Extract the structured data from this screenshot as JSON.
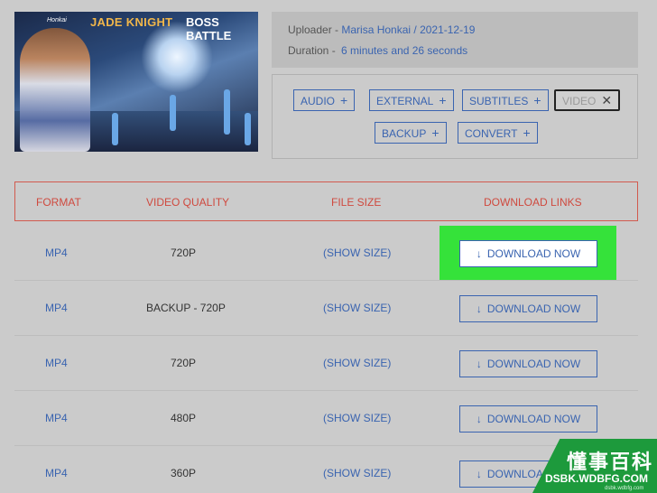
{
  "video": {
    "thumbnail": {
      "title_part1": "JADE KNIGHT",
      "title_part2": "BOSS BATTLE",
      "badge": "Honkai"
    },
    "uploader_label": "Uploader -",
    "uploader_value": "Marisa Honkai / 2021-12-19",
    "duration_label": "Duration -",
    "duration_value": "6 minutes and 26 seconds"
  },
  "tags": [
    {
      "label": "AUDIO",
      "icon": "plus-icon",
      "active": false
    },
    {
      "label": "EXTERNAL",
      "icon": "plus-icon",
      "active": false
    },
    {
      "label": "SUBTITLES",
      "icon": "plus-icon",
      "active": false
    },
    {
      "label": "VIDEO",
      "icon": "close-icon",
      "active": true
    },
    {
      "label": "BACKUP",
      "icon": "plus-icon",
      "active": false
    },
    {
      "label": "CONVERT",
      "icon": "plus-icon",
      "active": false
    }
  ],
  "table": {
    "headers": [
      "FORMAT",
      "VIDEO QUALITY",
      "FILE SIZE",
      "DOWNLOAD LINKS"
    ],
    "rows": [
      {
        "format": "MP4",
        "quality": "720P",
        "size": "(SHOW SIZE)",
        "link": "DOWNLOAD NOW",
        "highlighted": true
      },
      {
        "format": "MP4",
        "quality": "BACKUP - 720P",
        "size": "(SHOW SIZE)",
        "link": "DOWNLOAD NOW",
        "highlighted": false
      },
      {
        "format": "MP4",
        "quality": "720P",
        "size": "(SHOW SIZE)",
        "link": "DOWNLOAD NOW",
        "highlighted": false
      },
      {
        "format": "MP4",
        "quality": "480P",
        "size": "(SHOW SIZE)",
        "link": "DOWNLOAD NOW",
        "highlighted": false
      },
      {
        "format": "MP4",
        "quality": "360P",
        "size": "(SHOW SIZE)",
        "link": "DOWNLOAD NOW",
        "highlighted": false
      }
    ]
  },
  "watermark": {
    "chinese": "懂事百科",
    "site": "DSBK.WDBFG.COM",
    "small": "dsbk.wdbfg.com"
  },
  "colors": {
    "accent_blue": "#3a64b0",
    "header_red": "#cf4a3f",
    "highlight_green": "#35e23a",
    "background": "#cbcbcb"
  }
}
